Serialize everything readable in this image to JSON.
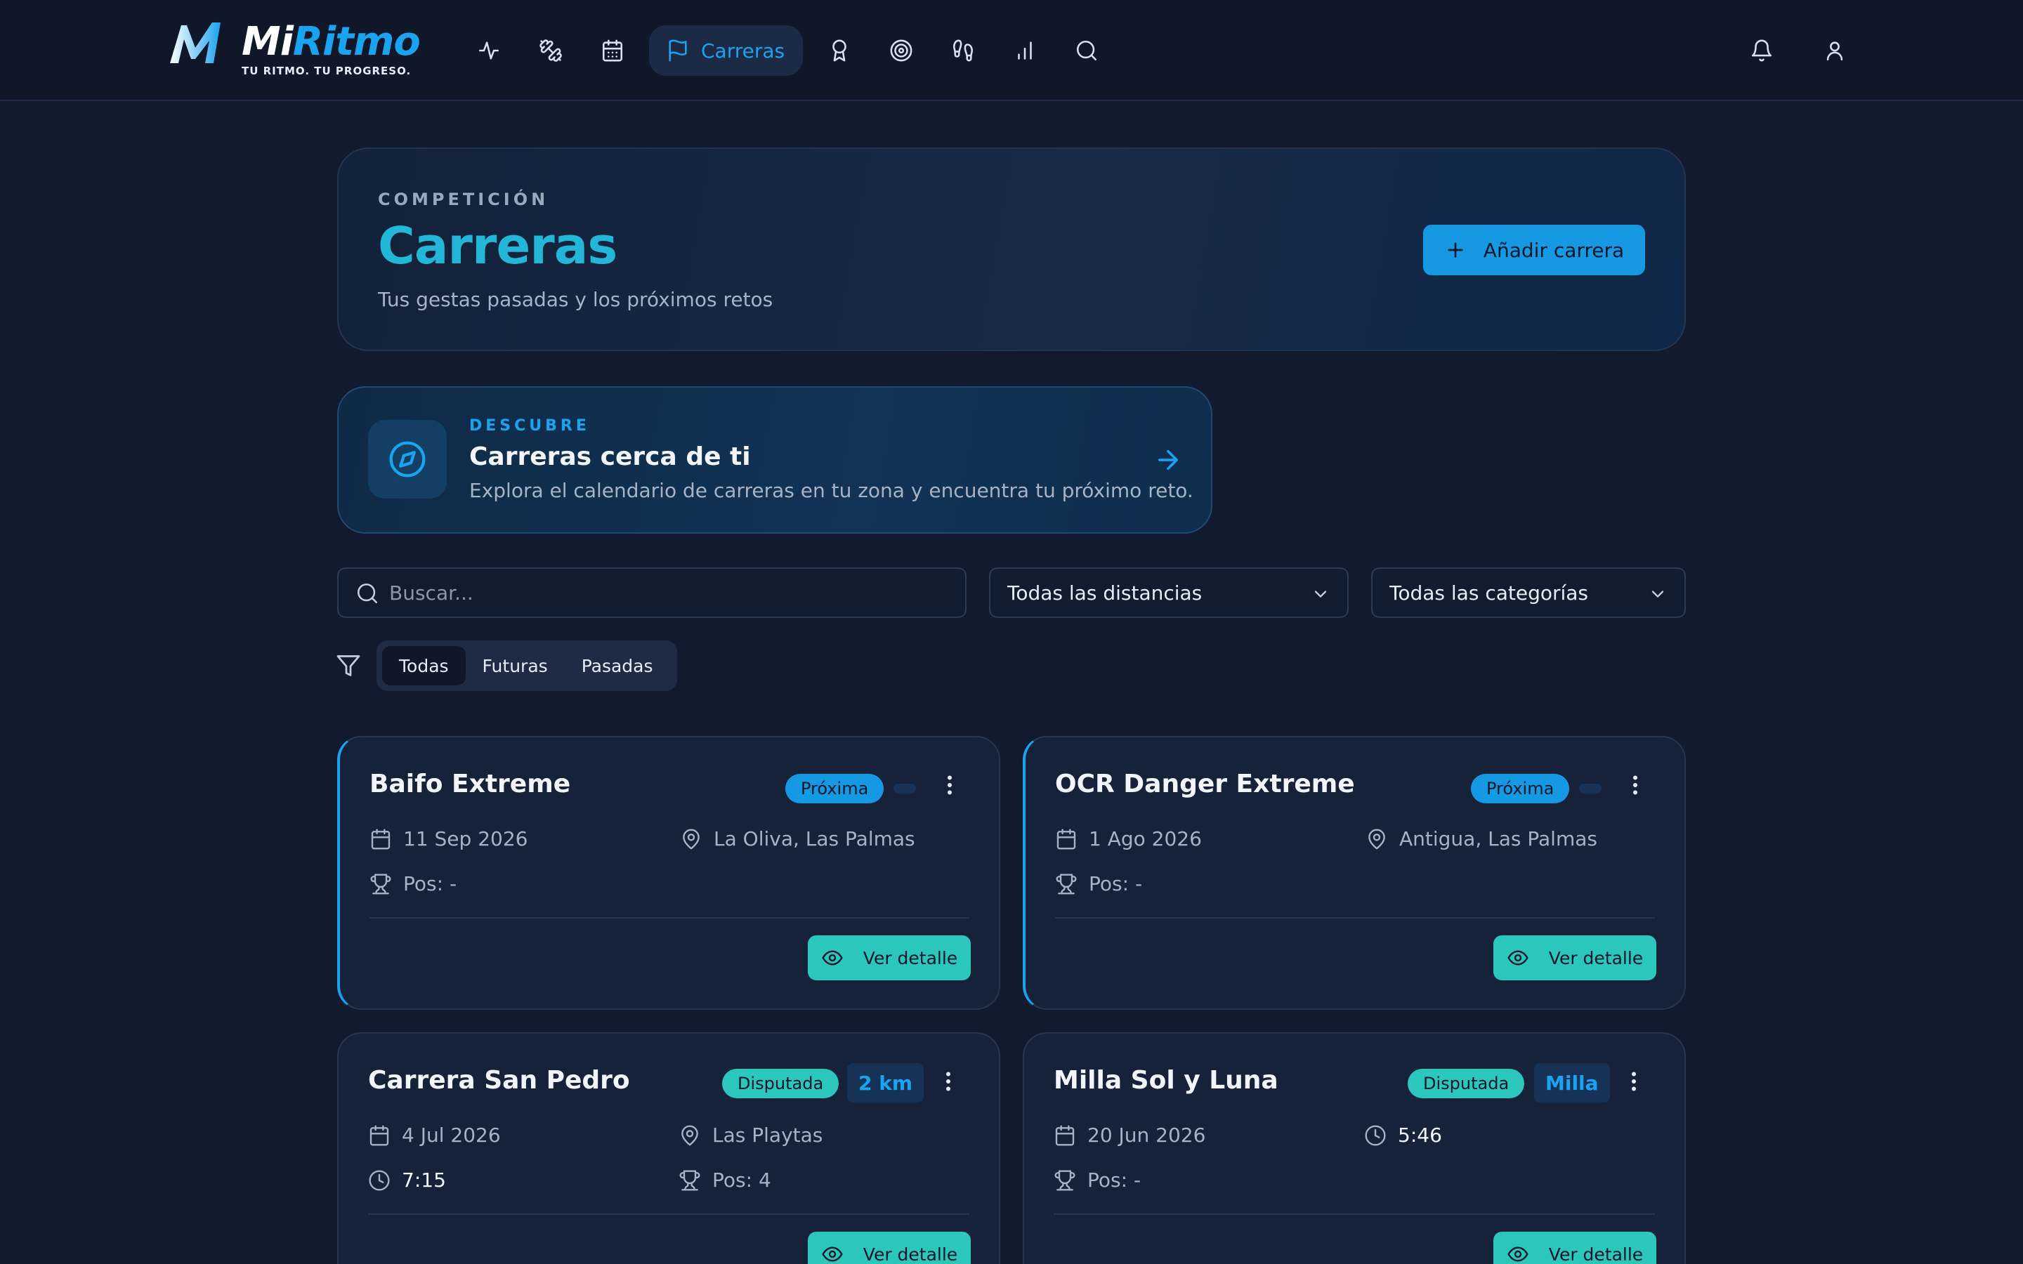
{
  "brand": {
    "name_a": "Mi",
    "name_b": "Ritmo",
    "tagline": "TU RITMO. TU PROGRESO."
  },
  "nav": {
    "items": [
      {
        "icon": "activity-icon"
      },
      {
        "icon": "dumbbell-icon"
      },
      {
        "icon": "calendar-icon"
      },
      {
        "icon": "flag-icon",
        "label": "Carreras",
        "active": true
      },
      {
        "icon": "award-icon"
      },
      {
        "icon": "target-icon"
      },
      {
        "icon": "footprints-icon"
      },
      {
        "icon": "bar-chart-icon"
      },
      {
        "icon": "search-icon"
      }
    ],
    "right": [
      {
        "icon": "bell-icon"
      },
      {
        "icon": "user-icon"
      }
    ]
  },
  "hero": {
    "eyebrow": "COMPETICIÓN",
    "title": "Carreras",
    "subtitle": "Tus gestas pasadas y los próximos retos",
    "add_label": "Añadir carrera"
  },
  "discover": {
    "eyebrow": "DESCUBRE",
    "title": "Carreras cerca de ti",
    "subtitle": "Explora el calendario de carreras en tu zona y encuentra tu próximo reto."
  },
  "filters": {
    "search_placeholder": "Buscar...",
    "distance": "Todas las distancias",
    "category": "Todas las categorías",
    "segments": [
      "Todas",
      "Futuras",
      "Pasadas"
    ],
    "active_segment": "Todas"
  },
  "races": [
    {
      "title": "Baifo Extreme",
      "status": "Próxima",
      "distance": "",
      "date": "11 Sep 2026",
      "location": "La Oliva, Las Palmas",
      "position": "Pos: -",
      "detail_label": "Ver detalle"
    },
    {
      "title": "OCR Danger Extreme",
      "status": "Próxima",
      "distance": "",
      "date": "1 Ago 2026",
      "location": "Antigua, Las Palmas",
      "position": "Pos: -",
      "detail_label": "Ver detalle"
    },
    {
      "title": "Carrera San Pedro",
      "status": "Disputada",
      "distance": "2 km",
      "date": "4 Jul 2026",
      "location": "Las Playtas",
      "time": "7:15",
      "position": "Pos: 4",
      "detail_label": "Ver detalle"
    },
    {
      "title": "Milla Sol y Luna",
      "status": "Disputada",
      "distance": "Milla",
      "date": "20 Jun 2026",
      "time": "5:46",
      "position": "Pos: -",
      "detail_label": "Ver detalle"
    }
  ],
  "colors": {
    "accent": "#1aa3f0",
    "teal": "#2bc6bc",
    "background": "#111a2e",
    "card": "#15223a"
  }
}
